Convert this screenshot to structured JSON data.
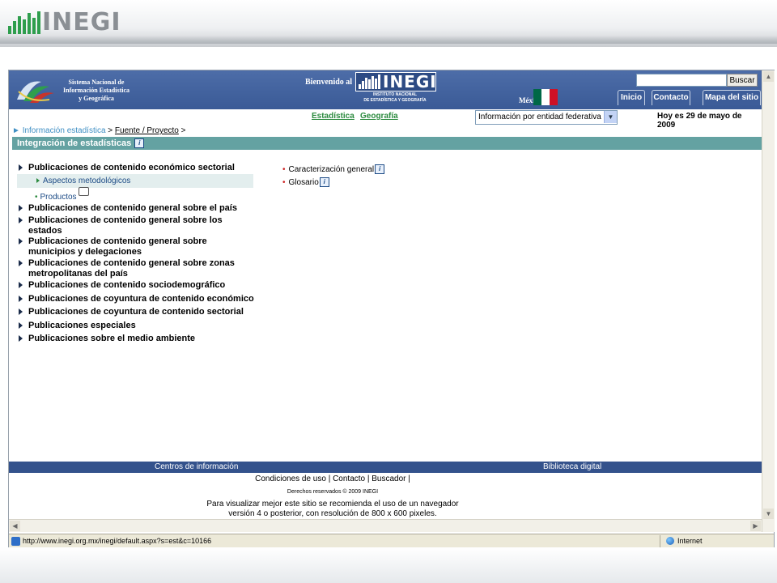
{
  "slide": {
    "logo_text": "INEGI"
  },
  "header": {
    "sninfo_line1": "Sistema Nacional de",
    "sninfo_line2": "Información Estadística",
    "sninfo_line3": "y Geográfica",
    "welcome": "Bienvenido al",
    "inegi_logo_text": "INEGI",
    "inegi_sub1": "INSTITUTO NACIONAL",
    "inegi_sub2": "DE ESTADÍSTICA Y GEOGRAFÍA",
    "country_label": "México",
    "flag_colors": [
      "#006847",
      "#ffffff",
      "#ce1126"
    ],
    "search": {
      "placeholder": "",
      "value": "",
      "button_label": "Buscar"
    },
    "nav_tabs": [
      {
        "label": "Inicio"
      },
      {
        "label": "Contacto"
      },
      {
        "label": "Mapa del sitio"
      }
    ]
  },
  "subbar": {
    "link_estadistica": "Estadística",
    "link_geografia": "Geografía",
    "entity_select_value": "Información por entidad federativa",
    "date_text": "Hoy es 29 de mayo de 2009"
  },
  "breadcrumb": {
    "arrow": "►",
    "item1": "Información estadística",
    "sep1": " > ",
    "item2": "Fuente / Proyecto",
    "sep2": " >"
  },
  "section": {
    "title": "Integración de estadísticas",
    "bar_color": "#64a2a2"
  },
  "left_menu": {
    "items": [
      {
        "label": "Publicaciones de contenido económico sectorial"
      },
      {
        "label": "Publicaciones de contenido general sobre el país"
      },
      {
        "label": "Publicaciones de contenido general sobre los estados"
      },
      {
        "label": "Publicaciones de contenido general sobre municipios y delegaciones"
      },
      {
        "label": "Publicaciones de contenido general sobre zonas metropolitanas del país"
      },
      {
        "label": "Publicaciones de contenido sociodemográfico"
      },
      {
        "label": "Publicaciones de coyuntura de contenido económico"
      },
      {
        "label": "Publicaciones de coyuntura de contenido sectorial"
      },
      {
        "label": "Publicaciones especiales"
      },
      {
        "label": "Publicaciones sobre el medio ambiente"
      }
    ],
    "sub_aspectos": "Aspectos metodológicos",
    "sub_productos": "Productos"
  },
  "right_links": [
    {
      "label": "Caracterización general"
    },
    {
      "label": "Glosario"
    }
  ],
  "footer": {
    "centros": "Centros de información",
    "biblioteca": "Biblioteca digital",
    "links": "Condiciones de uso | Contacto | Buscador |",
    "copyright": "Derechos reservados © 2009 INEGI",
    "note_line1": "Para visualizar mejor este sitio se recomienda el uso de un navegador",
    "note_line2": "versión 4 o posterior, con resolución de 800 x 600 pixeles."
  },
  "statusbar": {
    "url": "http://www.inegi.org.mx/inegi/default.aspx?s=est&c=10166",
    "zone": "Internet"
  }
}
